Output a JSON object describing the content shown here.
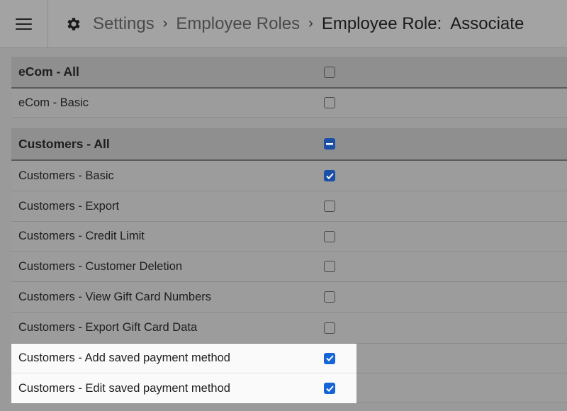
{
  "header": {
    "menu_icon": "hamburger-icon",
    "settings_icon": "gear-icon",
    "breadcrumb": {
      "settings": "Settings",
      "employee_roles": "Employee Roles",
      "current": "Employee Role:  Associate"
    }
  },
  "groups": [
    {
      "header": {
        "label": "eCom - All",
        "state": "unchecked"
      },
      "items": [
        {
          "label": "eCom - Basic",
          "state": "unchecked"
        }
      ]
    },
    {
      "header": {
        "label": "Customers - All",
        "state": "partial"
      },
      "items": [
        {
          "label": "Customers - Basic",
          "state": "checked"
        },
        {
          "label": "Customers - Export",
          "state": "unchecked"
        },
        {
          "label": "Customers - Credit Limit",
          "state": "unchecked"
        },
        {
          "label": "Customers - Customer Deletion",
          "state": "unchecked"
        },
        {
          "label": "Customers - View Gift Card Numbers",
          "state": "unchecked"
        },
        {
          "label": "Customers - Export Gift Card Data",
          "state": "unchecked"
        },
        {
          "label": "Customers - Add saved payment method",
          "state": "checked"
        },
        {
          "label": "Customers - Edit saved payment method",
          "state": "checked"
        }
      ]
    }
  ],
  "colors": {
    "checkbox_checked": "#1565d8"
  }
}
